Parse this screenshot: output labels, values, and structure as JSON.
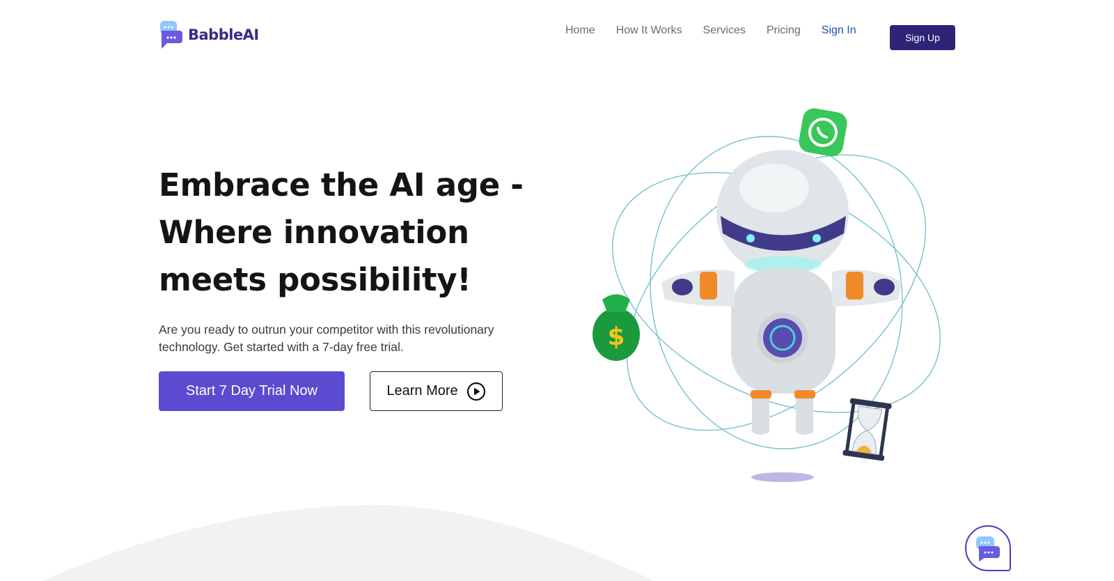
{
  "brand": {
    "name": "BabbleAI"
  },
  "nav": {
    "items": [
      "Home",
      "How It Works",
      "Services",
      "Pricing"
    ],
    "sign_in": "Sign In",
    "sign_up": "Sign Up"
  },
  "hero": {
    "title_line1": "Embrace the AI age -",
    "title_line2": "Where innovation",
    "title_line3": "meets possibility!",
    "subtitle": "Are you ready to outrun your competitor with this revolutionary technology. Get started with a 7-day free trial.",
    "primary_button": "Start 7 Day Trial Now",
    "secondary_button": "Learn More"
  },
  "colors": {
    "brand_dark": "#2d2478",
    "brand_primary": "#5a4bd1",
    "link_blue": "#1c4fb5",
    "orbit": "#5bb8c4"
  },
  "icons": [
    "chat-bubble-logo-icon",
    "play-circle-icon",
    "whatsapp-icon",
    "money-bag-icon",
    "hourglass-icon",
    "chat-widget-icon"
  ]
}
